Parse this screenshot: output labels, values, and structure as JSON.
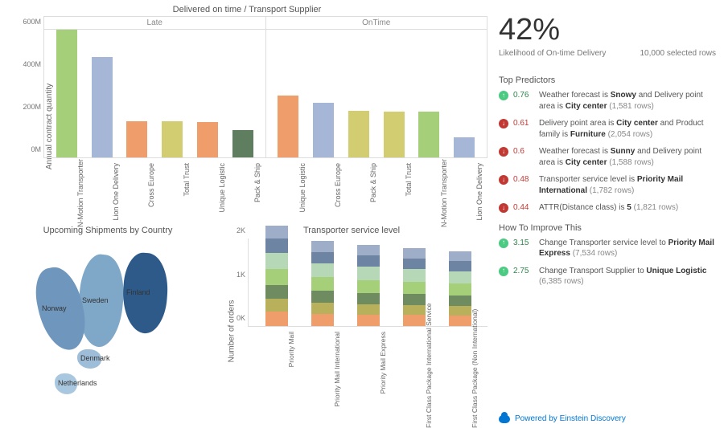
{
  "chart_data": {
    "main_bar": {
      "type": "bar",
      "title": "Delivered on time / Transport Supplier",
      "ylabel": "Annual contract quantity",
      "ylim": [
        0,
        600
      ],
      "y_unit": "M",
      "y_ticks": [
        0,
        200,
        400,
        600
      ],
      "groups": [
        {
          "name": "Late",
          "bars": [
            {
              "label": "N-Motion Transporter",
              "value": 640,
              "color": "#a6cf7a"
            },
            {
              "label": "Lion One Delivery",
              "value": 470,
              "color": "#a6b6d6"
            },
            {
              "label": "Cross Europe",
              "value": 170,
              "color": "#ef9d6b"
            },
            {
              "label": "Total Trust",
              "value": 170,
              "color": "#d2cd71"
            },
            {
              "label": "Unique Logistic",
              "value": 165,
              "color": "#ef9d6b"
            },
            {
              "label": "Pack & Ship",
              "value": 130,
              "color": "#5f7d5f"
            }
          ]
        },
        {
          "name": "OnTime",
          "bars": [
            {
              "label": "Unique Logistic",
              "value": 290,
              "color": "#ef9d6b"
            },
            {
              "label": "Cross Europe",
              "value": 255,
              "color": "#a6b6d6"
            },
            {
              "label": "Pack & Ship",
              "value": 220,
              "color": "#d2cd71"
            },
            {
              "label": "Total Trust",
              "value": 215,
              "color": "#d2cd71"
            },
            {
              "label": "N-Motion Transporter",
              "value": 215,
              "color": "#a6cf7a"
            },
            {
              "label": "Lion One Delivery",
              "value": 95,
              "color": "#a6b6d6"
            }
          ]
        }
      ]
    },
    "shipments_map": {
      "type": "map",
      "title": "Upcoming Shipments by Country",
      "countries": [
        {
          "name": "Sweden",
          "shade": "#7fa7c8"
        },
        {
          "name": "Finland",
          "shade": "#2e5a8a"
        },
        {
          "name": "Norway",
          "shade": "#6f96bd"
        },
        {
          "name": "Denmark",
          "shade": "#9dbdd8"
        },
        {
          "name": "Netherlands",
          "shade": "#a9c8e0"
        }
      ]
    },
    "service_level": {
      "type": "bar-stacked",
      "title": "Transporter service level",
      "ylabel": "Number of orders",
      "ylim": [
        0,
        2000
      ],
      "y_unit": "K",
      "y_ticks": [
        0,
        1,
        2
      ],
      "categories": [
        "Priority Mail",
        "Priority Mail International",
        "Priority Mail Express",
        "First Class Package International Service",
        "First Class Package (Non International)"
      ],
      "stack_colors": [
        "#ef9d6b",
        "#b8b05a",
        "#6e8c5f",
        "#a6cf7a",
        "#b7d8b7",
        "#6d85a3",
        "#9eaec8"
      ],
      "series_totals": [
        2300,
        1950,
        1850,
        1780,
        1700
      ]
    }
  },
  "prediction": {
    "percent": "42%",
    "subtitle": "Likelihood of On-time Delivery",
    "rows_selected": "10,000 selected rows",
    "top_predictors_title": "Top Predictors",
    "predictors": [
      {
        "sign": "pos",
        "value": "0.76",
        "pre": "Weather forecast is ",
        "b1": "Snowy",
        "mid": " and Delivery point area is ",
        "b2": "City center",
        "rows": " (1,581 rows)"
      },
      {
        "sign": "neg",
        "value": "0.61",
        "pre": "Delivery point area is ",
        "b1": "City center",
        "mid": " and Product family is ",
        "b2": "Furniture",
        "rows": " (2,054 rows)"
      },
      {
        "sign": "neg",
        "value": "0.6",
        "pre": "Weather forecast is ",
        "b1": "Sunny",
        "mid": " and Delivery point area is ",
        "b2": "City center",
        "rows": " (1,588 rows)"
      },
      {
        "sign": "neg",
        "value": "0.48",
        "pre": "Transporter service level is ",
        "b1": "Priority Mail International",
        "mid": "",
        "b2": "",
        "rows": " (1,782 rows)"
      },
      {
        "sign": "neg",
        "value": "0.44",
        "pre": "ATTR(Distance class) is ",
        "b1": "5",
        "mid": "",
        "b2": "",
        "rows": " (1,821 rows)"
      }
    ],
    "improve_title": "How To Improve This",
    "improvements": [
      {
        "sign": "pos",
        "value": "3.15",
        "pre": "Change Transporter service level to ",
        "b1": "Priority Mail Express",
        "rows": " (7,534 rows)"
      },
      {
        "sign": "pos",
        "value": "2.75",
        "pre": "Change Transport Supplier to ",
        "b1": "Unique Logistic",
        "rows": " (6,385 rows)"
      }
    ],
    "footer": "Powered by Einstein Discovery"
  }
}
